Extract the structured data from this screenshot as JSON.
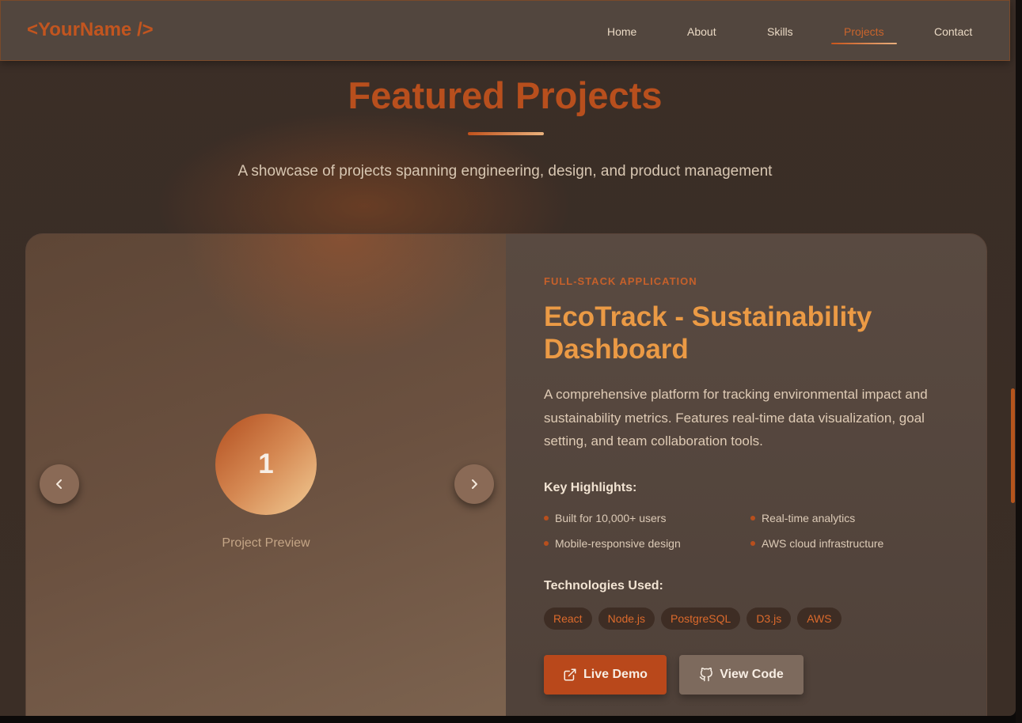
{
  "nav": {
    "logo": "<YourName />",
    "links": [
      "Home",
      "About",
      "Skills",
      "Projects",
      "Contact"
    ],
    "active": "Projects"
  },
  "hero": {
    "title": "Featured Projects",
    "subtitle": "A showcase of projects spanning engineering, design, and product management"
  },
  "project": {
    "number": "1",
    "preview_label": "Project Preview",
    "category": "FULL-STACK APPLICATION",
    "title": "EcoTrack - Sustainability Dashboard",
    "description": "A comprehensive platform for tracking environmental impact and sustainability metrics. Features real-time data visualization, goal setting, and team collaboration tools.",
    "highlights_heading": "Key Highlights:",
    "highlights": [
      "Built for 10,000+ users",
      "Real-time analytics",
      "Mobile-responsive design",
      "AWS cloud infrastructure"
    ],
    "tech_heading": "Technologies Used:",
    "technologies": [
      "React",
      "Node.js",
      "PostgreSQL",
      "D3.js",
      "AWS"
    ],
    "demo_label": "Live Demo",
    "code_label": "View Code"
  },
  "icons": {
    "prev": "chevron-left-icon",
    "next": "chevron-right-icon",
    "demo": "external-link-icon",
    "code": "github-icon"
  },
  "colors": {
    "accent": "#b9481b",
    "title_orange": "#eb9a45",
    "background": "#3b2e27"
  }
}
